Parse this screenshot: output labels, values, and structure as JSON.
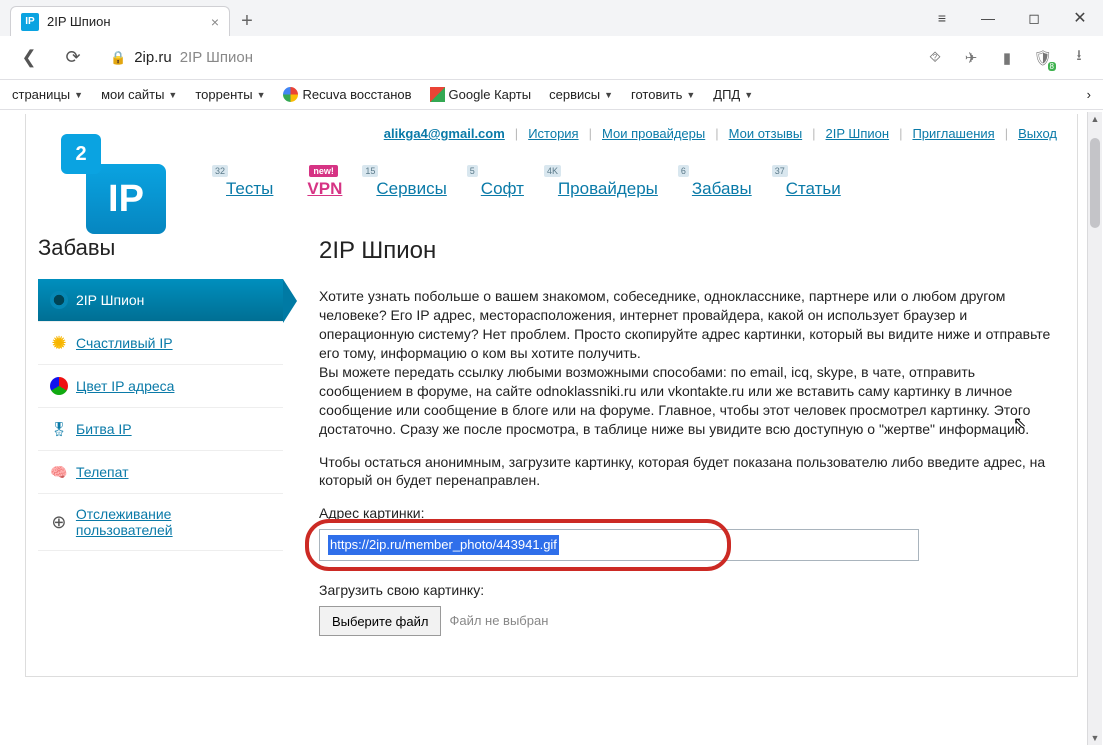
{
  "browser": {
    "tab_title": "2IP Шпион",
    "url_domain": "2ip.ru",
    "url_rest": "2IP Шпион",
    "shield_badge": "8",
    "bookmarks": [
      {
        "label": "страницы",
        "dd": true
      },
      {
        "label": "мои сайты",
        "dd": true
      },
      {
        "label": "торренты",
        "dd": true
      },
      {
        "label": "Recuva восстанов",
        "icon": "g"
      },
      {
        "label": "Google Карты",
        "icon": "map"
      },
      {
        "label": "сервисы",
        "dd": true
      },
      {
        "label": "готовить",
        "dd": true
      },
      {
        "label": "ДПД",
        "dd": true
      }
    ]
  },
  "top_links": {
    "email": "alikga4@gmail.com",
    "items": [
      "История",
      "Мои провайдеры",
      "Мои отзывы",
      "2IP Шпион",
      "Приглашения",
      "Выход"
    ]
  },
  "main_nav": [
    {
      "label": "Тесты",
      "count": "32"
    },
    {
      "label": "VPN",
      "new": true,
      "vpn": true
    },
    {
      "label": "Сервисы",
      "count": "15"
    },
    {
      "label": "Софт",
      "count": "5"
    },
    {
      "label": "Провайдеры",
      "count": "4K"
    },
    {
      "label": "Забавы",
      "count": "6"
    },
    {
      "label": "Статьи",
      "count": "37"
    }
  ],
  "sidebar": {
    "title": "Забавы",
    "items": [
      {
        "label": "2IP Шпион",
        "active": true,
        "icon": "eye"
      },
      {
        "label": "Счастливый IP",
        "icon": "sun"
      },
      {
        "label": "Цвет IP адреса",
        "icon": "ball"
      },
      {
        "label": "Битва IP",
        "icon": "medal"
      },
      {
        "label": "Телепат",
        "icon": "brain"
      },
      {
        "label": "Отслеживание пользователей",
        "icon": "target"
      }
    ]
  },
  "content": {
    "heading": "2IP Шпион",
    "para1": "Хотите узнать побольше о вашем знакомом, собеседнике, однокласснике, партнере или о любом другом человеке? Его IP адрес, месторасположения, интернет провайдера, какой он использует браузер и операционную систему? Нет проблем. Просто скопируйте адрес картинки, который вы видите ниже и отправьте его тому, информацию о ком вы хотите получить.",
    "para2": "Вы можете передать ссылку любыми возможными способами: по email, icq, skype, в чате, отправить сообщением в форуме, на сайте odnoklassniki.ru или vkontakte.ru или же вставить саму картинку в личное сообщение или сообщение в блоге или на форуме. Главное, чтобы этот человек просмотрел картинку. Этого достаточно. Сразу же после просмотра, в таблице ниже  вы увидите всю доступную о \"жертве\" информацию.",
    "para3": "Чтобы остаться анонимным, загрузите картинку, которая будет показана пользователю либо введите адрес, на который он будет перенаправлен.",
    "url_label": "Адрес картинки:",
    "url_value": "https://2ip.ru/member_photo/443941.gif",
    "upload_label": "Загрузить свою картинку:",
    "file_btn": "Выберите файл",
    "file_status": "Файл не выбран"
  },
  "logo": {
    "small": "2",
    "big": "IP"
  }
}
